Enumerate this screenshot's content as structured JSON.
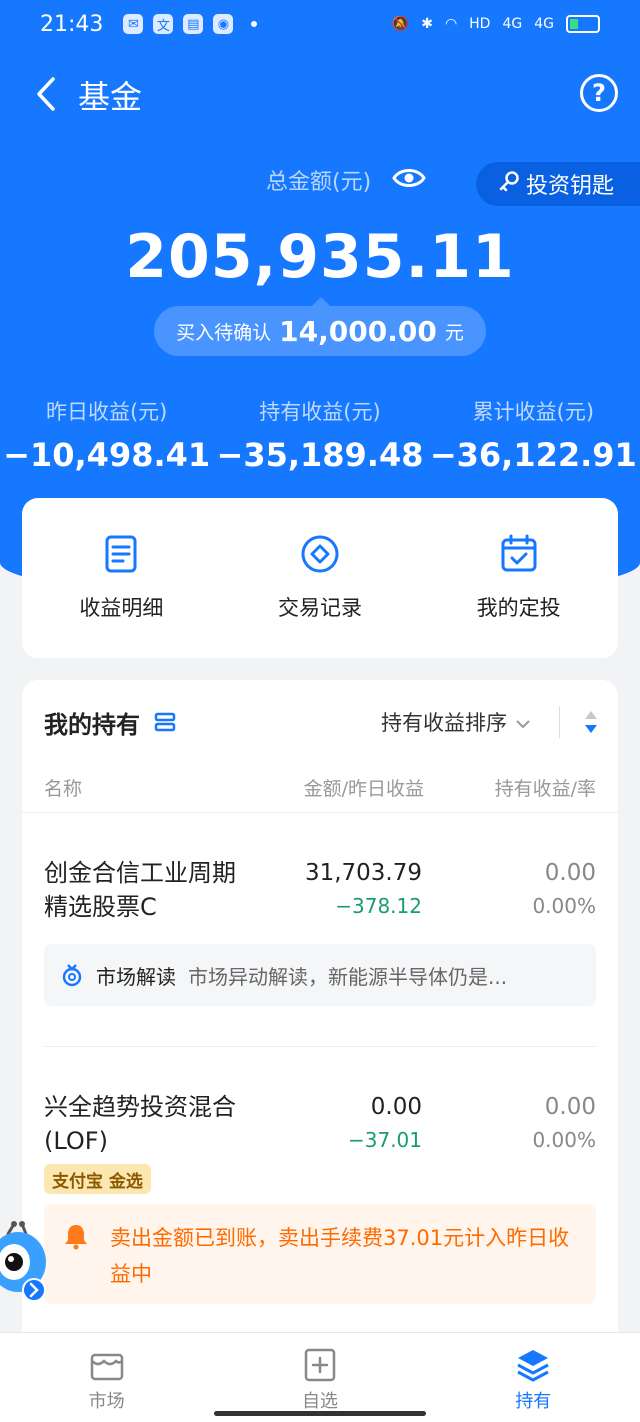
{
  "status": {
    "time": "21:43",
    "hd": "HD",
    "net1": "4G",
    "net2": "4G"
  },
  "nav": {
    "title": "基金"
  },
  "summary": {
    "total_label": "总金额(元)",
    "key_button": "投资钥匙",
    "total_amount": "205,935.11",
    "pending_label": "买入待确认",
    "pending_value": "14,000.00",
    "pending_unit": "元"
  },
  "stats": [
    {
      "label": "昨日收益(元)",
      "value": "−10,498.41"
    },
    {
      "label": "持有收益(元)",
      "value": "−35,189.48"
    },
    {
      "label": "累计收益(元)",
      "value": "−36,122.91"
    }
  ],
  "actions": [
    {
      "label": "收益明细"
    },
    {
      "label": "交易记录"
    },
    {
      "label": "我的定投"
    }
  ],
  "holdings": {
    "title": "我的持有",
    "sort_label": "持有收益排序",
    "columns": [
      "名称",
      "金额/昨日收益",
      "持有收益/率"
    ],
    "funds": [
      {
        "name": "创金合信工业周期精选股票C",
        "amount": "31,703.79",
        "day_profit": "−378.12",
        "hold_profit": "0.00",
        "hold_rate": "0.00%",
        "market_tag": "市场解读",
        "market_text": "市场异动解读，新能源半导体仍是..."
      },
      {
        "name": "兴全趋势投资混合(LOF)",
        "amount": "0.00",
        "day_profit": "−37.01",
        "hold_profit": "0.00",
        "hold_rate": "0.00%",
        "badge": "支付宝 金选",
        "notice": "卖出金额已到账，卖出手续费37.01元计入昨日收益中"
      }
    ]
  },
  "tabbar": [
    {
      "label": "市场"
    },
    {
      "label": "自选"
    },
    {
      "label": "持有"
    }
  ],
  "colors": {
    "primary": "#1677ff",
    "loss": "#1a9d6e",
    "notice": "#ff6a00"
  }
}
